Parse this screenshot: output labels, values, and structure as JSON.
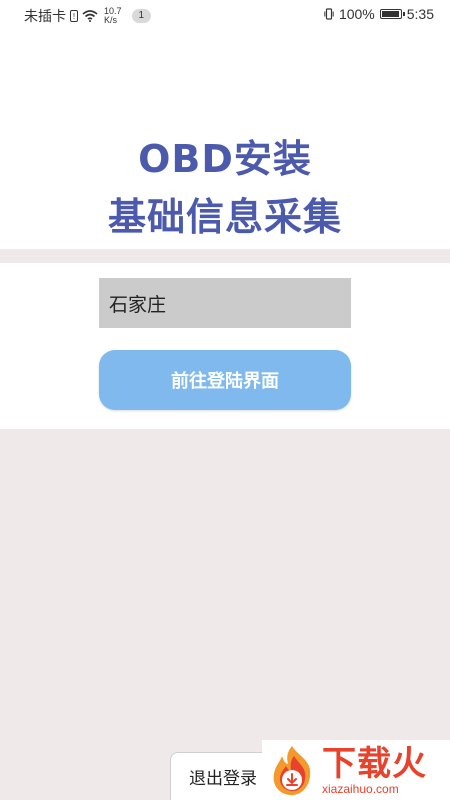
{
  "status_bar": {
    "carrier": "未插卡",
    "net_speed_value": "10.7",
    "net_speed_unit": "K/s",
    "notification_count": "1",
    "battery_percent": "100%",
    "time": "5:35",
    "battery_level": 1.0
  },
  "header": {
    "title_line1": "OBD安装",
    "title_line2": "基础信息采集"
  },
  "form": {
    "city_value": "石家庄",
    "go_button_label": "前往登陆界面"
  },
  "footer": {
    "logout_label": "退出登录"
  },
  "watermark": {
    "text_cn": "下载火",
    "text_en": "xiazaihuo.com"
  },
  "colors": {
    "title": "#4b5aac",
    "button": "#7fb9ee",
    "input_bg": "#cbcbcb",
    "page_bg": "#efe9e9",
    "watermark": "#e8412c"
  }
}
